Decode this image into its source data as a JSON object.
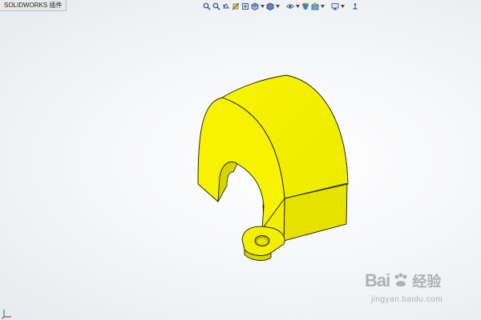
{
  "app": {
    "tab_label": "SOLIDWORKS 插件"
  },
  "view_toolbar": {
    "buttons": [
      {
        "icon": "zoom-to-fit-icon",
        "color": "#2a4f8f"
      },
      {
        "icon": "zoom-to-area-icon",
        "color": "#2a4f8f"
      },
      {
        "icon": "previous-view-icon",
        "color": "#2a4f8f"
      },
      {
        "icon": "section-view-icon",
        "color": "#c9a227"
      },
      {
        "icon": "dynamic-annotation-icon",
        "color": "#2a4f8f"
      },
      {
        "icon": "view-orientation-icon",
        "color": "#2a4f8f"
      },
      {
        "icon": "display-style-icon",
        "color": "#2a4f8f"
      },
      {
        "icon": "hide-show-items-icon",
        "color": "#2a4f8f"
      },
      {
        "icon": "edit-appearance-icon",
        "color": "#c0392b"
      },
      {
        "icon": "apply-scene-icon",
        "color": "#2a4f8f"
      },
      {
        "icon": "view-settings-icon",
        "color": "#2a4f8f"
      },
      {
        "icon": "display-pane-icon",
        "color": "#2a4f8f"
      }
    ]
  },
  "model": {
    "face_color": "#f5f000",
    "shade_color": "#d8d400",
    "edge_color": "#1a1a00"
  },
  "watermark": {
    "brand": "Bai",
    "product": "经验",
    "url": "jingyan.baidu.com"
  }
}
